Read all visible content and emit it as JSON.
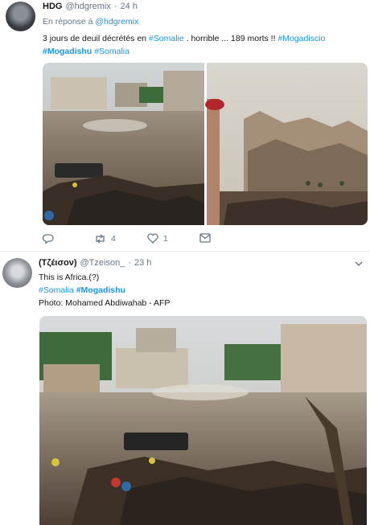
{
  "tweet1": {
    "name": "HDG",
    "handle": "@hdgremix",
    "dot": "·",
    "time": "24 h",
    "reply_prefix": "En réponse à",
    "reply_to": "@hdgremix",
    "line1_text": "3 jours de deuil décrétés en ",
    "line1_tag1": "#Somalie",
    "line1_mid": " . horrible ... 189 morts !! ",
    "line1_tag2": "#Mogadiscio",
    "line2_tag1": "#Mogadishu",
    "line2_sp": " ",
    "line2_tag2": "#Somalia",
    "retweets": "4",
    "likes": "1",
    "icons": {
      "reply": "reply-icon",
      "retweet": "retweet-icon",
      "like": "heart-icon",
      "dm": "envelope-icon"
    }
  },
  "tweet2": {
    "name": "(Τζέισον)",
    "handle": "@Tzeison_",
    "dot": "·",
    "time": "23 h",
    "line1": "This is Africa.(?)",
    "tag1": "#Somalia",
    "sp": " ",
    "tag2": "#Mogadishu",
    "photo_credit": "Photo: Mohamed Abdiwahab - AFP",
    "icons": {
      "menu": "chevron-down-icon"
    }
  },
  "colors": {
    "link": "#1b95e0",
    "muted": "#657786",
    "text": "#14171a",
    "divider": "#e6ecf0"
  }
}
